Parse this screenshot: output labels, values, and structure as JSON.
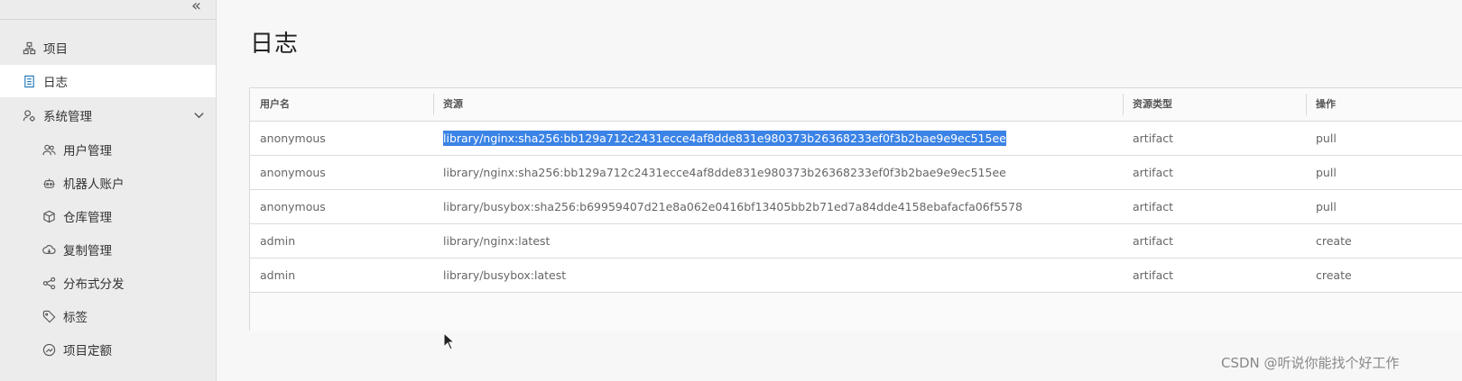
{
  "sidebar": {
    "collapse_icon": "«",
    "items": [
      {
        "label": "项目",
        "icon": "projects-icon"
      },
      {
        "label": "日志",
        "icon": "logs-icon",
        "active": true
      },
      {
        "label": "系统管理",
        "icon": "admin-icon",
        "expanded": true
      },
      {
        "label": "用户管理",
        "icon": "users-icon"
      },
      {
        "label": "机器人账户",
        "icon": "robot-icon"
      },
      {
        "label": "仓库管理",
        "icon": "registry-icon"
      },
      {
        "label": "复制管理",
        "icon": "replication-icon"
      },
      {
        "label": "分布式分发",
        "icon": "distribution-icon"
      },
      {
        "label": "标签",
        "icon": "tag-icon"
      },
      {
        "label": "项目定额",
        "icon": "quota-icon"
      }
    ]
  },
  "main": {
    "title": "日志",
    "table": {
      "columns": [
        "用户名",
        "资源",
        "资源类型",
        "操作"
      ],
      "rows": [
        [
          "anonymous",
          "library/nginx:sha256:bb129a712c2431ecce4af8dde831e980373b26368233ef0f3b2bae9e9ec515ee",
          "artifact",
          "pull"
        ],
        [
          "anonymous",
          "library/nginx:sha256:bb129a712c2431ecce4af8dde831e980373b26368233ef0f3b2bae9e9ec515ee",
          "artifact",
          "pull"
        ],
        [
          "anonymous",
          "library/busybox:sha256:b69959407d21e8a062e0416bf13405bb2b71ed7a84dde4158ebafacfa06f5578",
          "artifact",
          "pull"
        ],
        [
          "admin",
          "library/nginx:latest",
          "artifact",
          "create"
        ],
        [
          "admin",
          "library/busybox:latest",
          "artifact",
          "create"
        ]
      ]
    }
  },
  "watermark": "CSDN @听说你能找个好工作"
}
